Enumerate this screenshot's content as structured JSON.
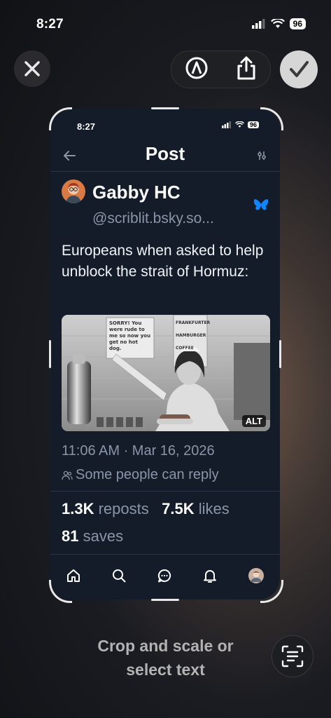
{
  "status_bar": {
    "time": "8:27",
    "battery": "96"
  },
  "post": {
    "status_time": "8:27",
    "status_battery": "96",
    "title": "Post",
    "author_name": "Gabby HC",
    "author_handle": "@scriblit.bsky.so...",
    "text": "Europeans when asked to help unblock the strait of Hormuz:",
    "image_alt_badge": "ALT",
    "image_sign_text": "SORRY! You were rude to me so now you get no hot dog.",
    "image_menu": [
      "FRANKFURTER",
      "HAMBURGER",
      "COFFEE"
    ],
    "timestamp": "11:06 AM · Mar 16, 2026",
    "reply_setting": "Some people can reply",
    "reposts_count": "1.3K",
    "reposts_label": "reposts",
    "likes_count": "7.5K",
    "likes_label": "likes",
    "saves_count": "81",
    "saves_label": "saves"
  },
  "hint": {
    "line1": "Crop and scale or",
    "line2": "select text"
  },
  "icons": {
    "close": "close-icon",
    "markup": "markup-icon",
    "share": "share-icon",
    "done": "checkmark-icon",
    "live_text": "text-recognition-icon"
  },
  "colors": {
    "accent_blue": "#1185fe",
    "post_bg": "#141c29",
    "muted_text": "#8a96a8"
  }
}
